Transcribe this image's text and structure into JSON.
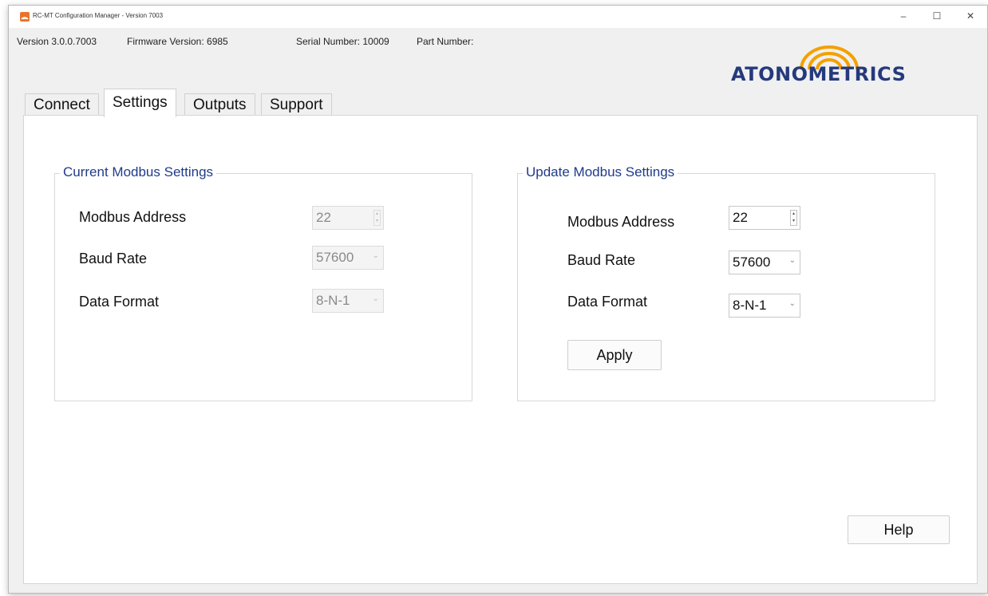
{
  "window": {
    "title": "RC-MT Configuration Manager - Version 7003",
    "controls": {
      "minimize": "–",
      "maximize": "☐",
      "close": "✕"
    }
  },
  "info": {
    "version": "Version 3.0.0.7003",
    "firmware": "Firmware Version: 6985",
    "serial": "Serial Number: 10009",
    "part": "Part Number:"
  },
  "logo": {
    "text": "ATONOMETRICS",
    "colors": {
      "text": "#253a7c",
      "arc": "#f5a000"
    }
  },
  "tabs": [
    {
      "label": "Connect"
    },
    {
      "label": "Settings",
      "active": true
    },
    {
      "label": "Outputs"
    },
    {
      "label": "Support"
    }
  ],
  "current": {
    "title": "Current Modbus Settings",
    "address_label": "Modbus Address",
    "address_value": "22",
    "baud_label": "Baud Rate",
    "baud_value": "57600",
    "format_label": "Data Format",
    "format_value": "8-N-1"
  },
  "update": {
    "title": "Update Modbus Settings",
    "address_label": "Modbus Address",
    "address_value": "22",
    "baud_label": "Baud Rate",
    "baud_value": "57600",
    "format_label": "Data Format",
    "format_value": "8-N-1",
    "apply_label": "Apply"
  },
  "help_label": "Help",
  "colors": {
    "group_title": "#1f3b8a",
    "panel": "#ffffff",
    "window_bg": "#f0f0f0"
  }
}
